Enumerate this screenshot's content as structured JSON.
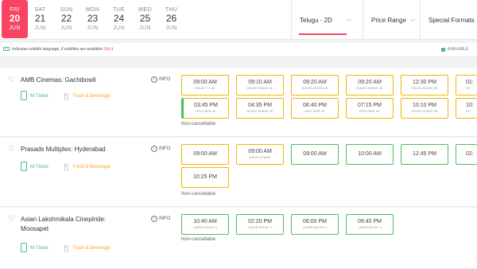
{
  "dates": [
    {
      "dow": "FRI",
      "day": "20",
      "mon": "JUN",
      "selected": true
    },
    {
      "dow": "SAT",
      "day": "21",
      "mon": "JUN"
    },
    {
      "dow": "SUN",
      "day": "22",
      "mon": "JUN"
    },
    {
      "dow": "MON",
      "day": "23",
      "mon": "JUN"
    },
    {
      "dow": "TUE",
      "day": "24",
      "mon": "JUN"
    },
    {
      "dow": "WED",
      "day": "25",
      "mon": "JUN"
    },
    {
      "dow": "THU",
      "day": "26",
      "mon": "JUN"
    }
  ],
  "filters": {
    "language": "Telugu - 2D",
    "price": "Price Range",
    "formats": "Special Formats"
  },
  "infobar": {
    "cc_icon": "CC",
    "message": "Indicates subtitle language, if subtitles are available",
    "got_it": "Got it",
    "available": "AVAILABLE"
  },
  "venues": [
    {
      "name": "AMB Cinemas: Gachibowli",
      "mticket": "M-Ticket",
      "food": "Food & Beverage",
      "info": "INFO",
      "note": "Non-cancellable",
      "rows": [
        [
          {
            "time": "09:00 AM",
            "fmt": "DOLBY 7.1 4K",
            "color": "yellow"
          },
          {
            "time": "09:10 AM",
            "fmt": "DOLBY ATMOS 4K",
            "color": "yellow"
          },
          {
            "time": "09:20 AM",
            "fmt": "DOLBY ATMOS 4K",
            "color": "yellow"
          },
          {
            "time": "09:20 AM",
            "fmt": "DOLBY ATMOS 4K",
            "color": "yellow"
          },
          {
            "time": "12:30 PM",
            "fmt": "DOLBY ATMOS 4K",
            "color": "yellow"
          },
          {
            "time": "01:",
            "fmt": "DO",
            "color": "yellow"
          }
        ],
        [
          {
            "time": "03:45 PM",
            "fmt": "RECLINER 4K",
            "color": "yellow",
            "bar": true
          },
          {
            "time": "04:35 PM",
            "fmt": "DOLBY ATMOS 4K",
            "color": "yellow"
          },
          {
            "time": "06:40 PM",
            "fmt": "RECLINER 4K",
            "color": "yellow"
          },
          {
            "time": "07:15 PM",
            "fmt": "RECLINER 4K",
            "color": "yellow"
          },
          {
            "time": "10:10 PM",
            "fmt": "DOLBY ATMOS 4K",
            "color": "yellow"
          },
          {
            "time": "10:",
            "fmt": "DO",
            "color": "yellow"
          }
        ]
      ]
    },
    {
      "name": "Prasads Multiplex: Hyderabad",
      "mticket": "M-Ticket",
      "food": "Food & Beverage",
      "info": "INFO",
      "note": "Non-cancellable",
      "rows": [
        [
          {
            "time": "09:00 AM",
            "fmt": "",
            "color": "yellow"
          },
          {
            "time": "09:00 AM",
            "fmt": "DOLBY ATMOS",
            "color": "yellow"
          },
          {
            "time": "09:00 AM",
            "fmt": "",
            "color": "green"
          },
          {
            "time": "10:00 AM",
            "fmt": "",
            "color": "green"
          },
          {
            "time": "12:45 PM",
            "fmt": "",
            "color": "green"
          },
          {
            "time": "02:",
            "fmt": "",
            "color": "green"
          }
        ],
        [
          {
            "time": "10:25 PM",
            "fmt": "",
            "color": "yellow"
          }
        ]
      ]
    },
    {
      "name": "Asian Lakshmikala Cineplride: Moosapet",
      "mticket": "M-Ticket",
      "food": "Food & Beverage",
      "info": "INFO",
      "note": "Non-cancellable",
      "rows": [
        [
          {
            "time": "10:40 AM",
            "fmt": "LASER DOLBY 4",
            "color": "green"
          },
          {
            "time": "02:20 PM",
            "fmt": "LASER DOLBY 4",
            "color": "green"
          },
          {
            "time": "06:00 PM",
            "fmt": "LASER DOLBY 4",
            "color": "green"
          },
          {
            "time": "09:40 PM",
            "fmt": "LASER DOLBY 4",
            "color": "green"
          }
        ]
      ]
    }
  ],
  "colors": {
    "accent": "#f84464",
    "available": "#4abd5d",
    "filling": "#f5b400",
    "mticket": "#49ba8e",
    "food": "#ffa426"
  },
  "icons": {
    "heart": "heart-icon",
    "mticket": "phone-icon",
    "food": "food-icon",
    "info": "info-icon",
    "chevron": "chevron-down-icon"
  }
}
